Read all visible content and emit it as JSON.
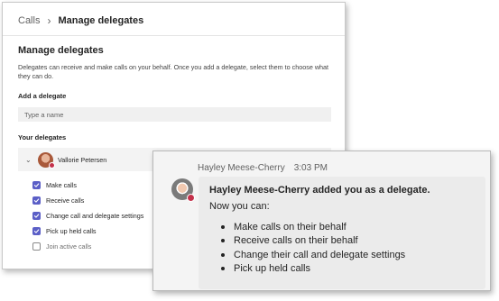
{
  "manage": {
    "breadcrumb": {
      "parent": "Calls",
      "current": "Manage delegates"
    },
    "title": "Manage delegates",
    "description": "Delegates can receive and make calls on your behalf. Once you add a delegate, select them to choose what they can do.",
    "add_label": "Add a delegate",
    "name_placeholder": "Type a name",
    "your_delegates_label": "Your delegates",
    "delegate": {
      "name": "Vallorie Petersen",
      "presence": "busy"
    },
    "permissions": [
      {
        "label": "Make calls",
        "checked": true
      },
      {
        "label": "Receive calls",
        "checked": true
      },
      {
        "label": "Change call and delegate settings",
        "checked": true
      },
      {
        "label": "Pick up held calls",
        "checked": true
      },
      {
        "label": "Join active calls",
        "checked": false
      }
    ]
  },
  "chat": {
    "sender": "Hayley Meese-Cherry",
    "time": "3:03 PM",
    "heading": "Hayley Meese-Cherry added you as a delegate.",
    "intro": "Now you can:",
    "items": [
      "Make calls on their behalf",
      "Receive calls on their behalf",
      "Change their call and delegate settings",
      "Pick up held calls"
    ]
  },
  "colors": {
    "accent": "#5b5fc7",
    "presence_busy": "#c4314b"
  }
}
